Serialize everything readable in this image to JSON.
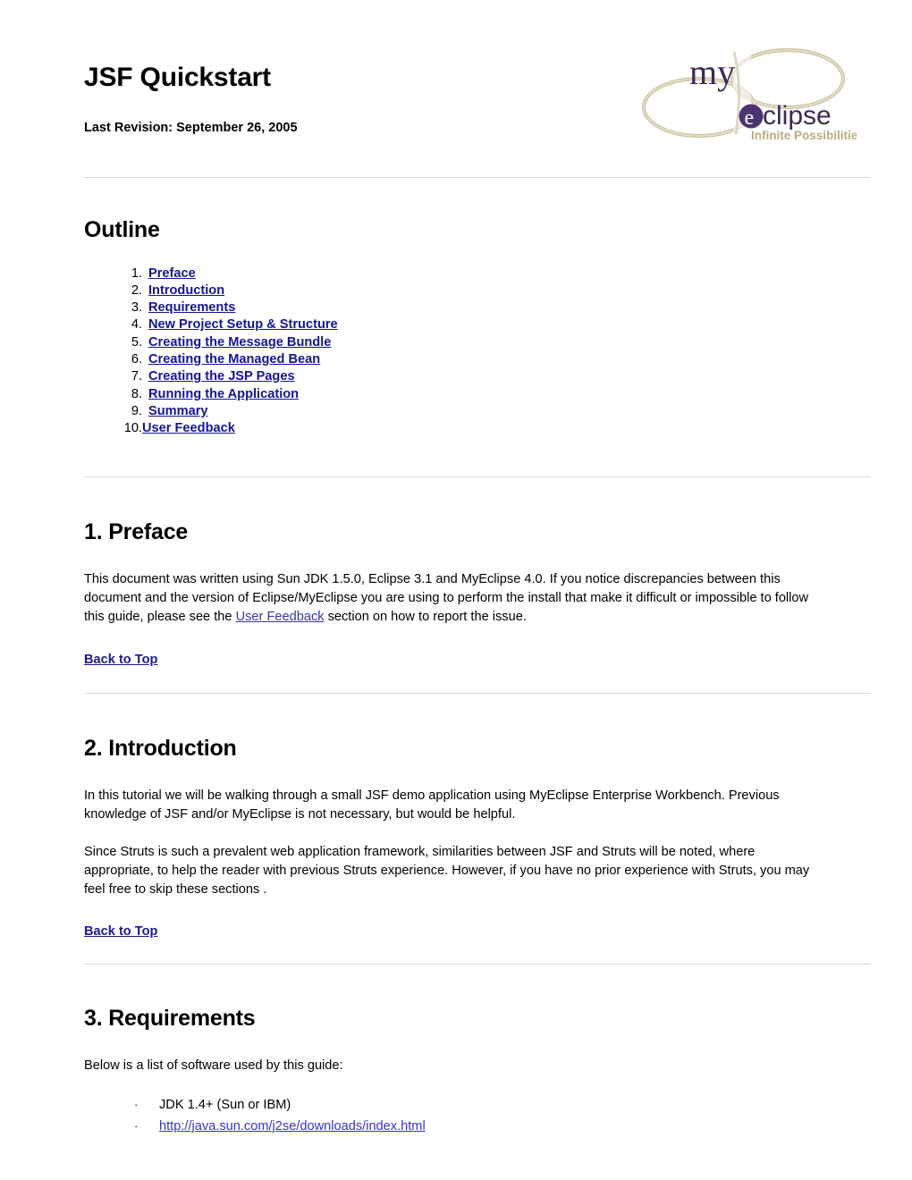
{
  "document": {
    "title": "JSF Quickstart",
    "revision_label": "Last Revision: September 26, 2005"
  },
  "logo": {
    "name": "myeclipse-logo",
    "word_my": "my",
    "word_eclipse": "eclipse",
    "tagline": "Infinite Possibilities",
    "colors": {
      "text_purple": "#3b2a55",
      "ribbon_beige": "#cfc7a8",
      "tagline_tan": "#b8ad84",
      "badge_purple": "#4b3570"
    }
  },
  "outline": {
    "heading": "Outline",
    "items": [
      {
        "num": "1.",
        "label": "Preface"
      },
      {
        "num": "2.",
        "label": "Introduction"
      },
      {
        "num": "3.",
        "label": "Requirements"
      },
      {
        "num": "4.",
        "label": "New Project Setup & Structure"
      },
      {
        "num": "5.",
        "label": "Creating the Message Bundle"
      },
      {
        "num": "6.",
        "label": "Creating the Managed Bean"
      },
      {
        "num": "7.",
        "label": "Creating the JSP Pages"
      },
      {
        "num": "8.",
        "label": "Running the Application"
      },
      {
        "num": "9.",
        "label": "Summary"
      },
      {
        "num": "10.",
        "label": "User Feedback"
      }
    ]
  },
  "sections": {
    "preface": {
      "heading": "1. Preface",
      "paragraph_before_link": "This document was written using Sun JDK 1.5.0, Eclipse 3.1 and MyEclipse 4.0. If you notice discrepancies between this document and the version of Eclipse/MyEclipse you are using to perform the install that make it difficult or impossible to follow this guide, please see the ",
      "inline_link": "User Feedback",
      "paragraph_after_link": " section on how to report the issue.",
      "back_to_top": "Back to Top"
    },
    "introduction": {
      "heading": "2. Introduction",
      "paragraph_1": "In this tutorial we will be walking through a small JSF demo application using MyEclipse Enterprise Workbench. Previous knowledge of JSF and/or MyEclipse is not necessary, but would be helpful.",
      "paragraph_2": "Since Struts is such a prevalent web application framework, similarities between JSF and Struts will be noted, where appropriate, to help the reader with previous Struts experience. However, if you have no prior experience with Struts, you may feel free to skip these sections .",
      "back_to_top": "Back to Top"
    },
    "requirements": {
      "heading": "3. Requirements",
      "intro": "Below is a list of software used by this guide:",
      "bullet": "·",
      "items": [
        {
          "text": "JDK 1.4+ (Sun or IBM)",
          "is_link": false
        },
        {
          "text": "http://java.sun.com/j2se/downloads/index.html",
          "is_link": true
        }
      ]
    }
  },
  "colors": {
    "rule": "#d8d8d8",
    "link_outline": "#151593",
    "link_inline": "#3636a8",
    "link_url": "#3333cc",
    "text": "#000000",
    "background": "#ffffff"
  }
}
